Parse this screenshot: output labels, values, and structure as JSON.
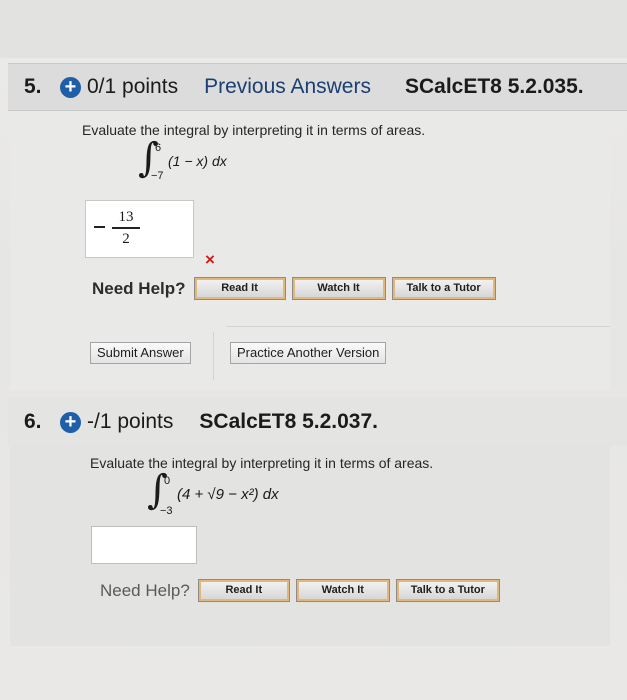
{
  "q5": {
    "number": "5.",
    "plus_icon": "+",
    "points": "0/1 points",
    "previous_answers": "Previous Answers",
    "code": "SCalcET8 5.2.035.",
    "prompt": "Evaluate the integral by interpreting it in terms of areas.",
    "integral": {
      "sign": "∫",
      "upper": "6",
      "lower": "−7",
      "expression": "(1 − x) dx"
    },
    "answer": {
      "sign": "−",
      "numerator": "13",
      "denominator": "2"
    },
    "result_icon": "×",
    "need_help": "Need Help?",
    "help_buttons": [
      "Read It",
      "Watch It",
      "Talk to a Tutor"
    ],
    "submit_label": "Submit Answer",
    "practice_label": "Practice Another Version"
  },
  "q6": {
    "number": "6.",
    "plus_icon": "+",
    "points": "-/1 points",
    "code": "SCalcET8 5.2.037.",
    "prompt": "Evaluate the integral by interpreting it in terms of areas.",
    "integral": {
      "sign": "∫",
      "upper": "0",
      "lower": "−3",
      "expression": "(4 + √9 − x²) dx"
    },
    "answer_value": "",
    "need_help": "Need Help?",
    "help_buttons": [
      "Read It",
      "Watch It",
      "Talk to a Tutor"
    ]
  },
  "colors": {
    "accent": "#1f5fa8",
    "error": "#d11a1a",
    "button_border": "#e2b77a"
  },
  "icons": {
    "plus": "plus-circle-icon",
    "wrong": "x-mark-icon"
  }
}
